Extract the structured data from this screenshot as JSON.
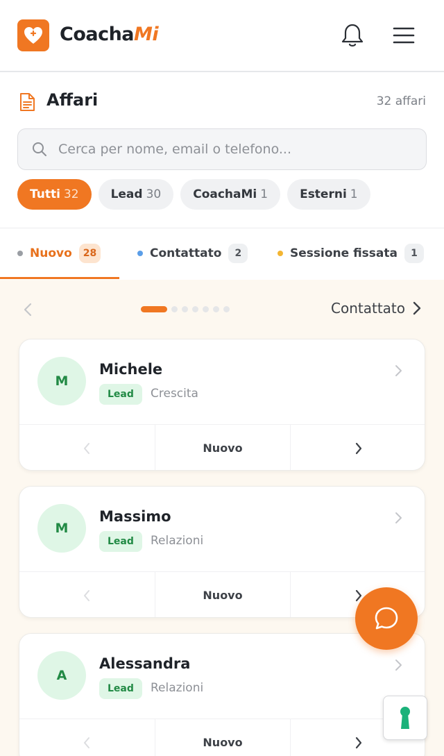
{
  "header": {
    "brand_primary": "Coacha",
    "brand_accent": "Mi",
    "brand_color": "#f07722",
    "icons": [
      "heart-logo-icon",
      "bell-icon",
      "hamburger-menu-icon"
    ]
  },
  "section": {
    "title": "Affari",
    "count_label": "32 affari",
    "icon": "document-icon"
  },
  "search": {
    "placeholder": "Cerca per nome, email o telefono...",
    "value": ""
  },
  "filters": [
    {
      "label": "Tutti",
      "count": "32",
      "active": true
    },
    {
      "label": "Lead",
      "count": "30",
      "active": false
    },
    {
      "label": "CoachaMi",
      "count": "1",
      "active": false
    },
    {
      "label": "Esterni",
      "count": "1",
      "active": false
    }
  ],
  "stage_tabs": [
    {
      "label": "Nuovo",
      "count": "28",
      "dot_color": "#9a9ea4",
      "active": true
    },
    {
      "label": "Contattato",
      "count": "2",
      "dot_color": "#5b9ee8",
      "active": false
    },
    {
      "label": "Sessione fissata",
      "count": "1",
      "dot_color": "#f3b532",
      "active": false
    }
  ],
  "pager": {
    "next_label": "Contattato",
    "dots": 7,
    "active_index": 0
  },
  "cards": [
    {
      "initial": "M",
      "name": "Michele",
      "tag": "Lead",
      "category": "Crescita",
      "stage": "Nuovo"
    },
    {
      "initial": "M",
      "name": "Massimo",
      "tag": "Lead",
      "category": "Relazioni",
      "stage": "Nuovo"
    },
    {
      "initial": "A",
      "name": "Alessandra",
      "tag": "Lead",
      "category": "Relazioni",
      "stage": "Nuovo"
    }
  ],
  "floating": {
    "chat_icon": "chat-bubble-icon",
    "keyhole_icon": "keyhole-icon"
  }
}
